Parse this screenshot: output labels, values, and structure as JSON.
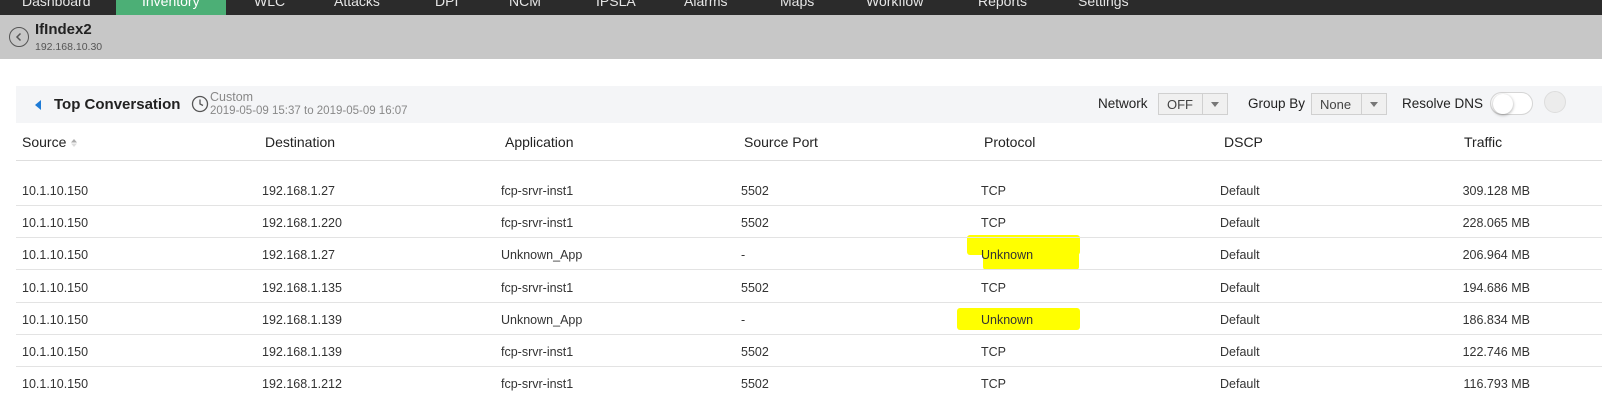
{
  "nav": {
    "items": [
      "Dashboard",
      "Inventory",
      "WLC",
      "Attacks",
      "DPI",
      "NCM",
      "IPSLA",
      "Alarms",
      "Maps",
      "Workflow",
      "Reports",
      "Settings"
    ],
    "active": "Inventory"
  },
  "device": {
    "name": "IfIndex2",
    "ip": "192.168.10.30"
  },
  "panel": {
    "title": "Top Conversation",
    "time_mode": "Custom",
    "time_range": "2019-05-09 15:37 to 2019-05-09 16:07",
    "network_label": "Network",
    "network_value": "OFF",
    "groupby_label": "Group By",
    "groupby_value": "None",
    "resolve_dns_label": "Resolve DNS",
    "resolve_dns_on": false
  },
  "table": {
    "columns": [
      "Source",
      "Destination",
      "Application",
      "Source Port",
      "Protocol",
      "DSCP",
      "Traffic"
    ],
    "sorted_by": "Source",
    "rows": [
      [
        "10.1.10.150",
        "192.168.1.27",
        "fcp-srvr-inst1",
        "5502",
        "TCP",
        "Default",
        "309.128 MB"
      ],
      [
        "10.1.10.150",
        "192.168.1.220",
        "fcp-srvr-inst1",
        "5502",
        "TCP",
        "Default",
        "228.065 MB"
      ],
      [
        "10.1.10.150",
        "192.168.1.27",
        "Unknown_App",
        "-",
        "Unknown",
        "Default",
        "206.964 MB"
      ],
      [
        "10.1.10.150",
        "192.168.1.135",
        "fcp-srvr-inst1",
        "5502",
        "TCP",
        "Default",
        "194.686 MB"
      ],
      [
        "10.1.10.150",
        "192.168.1.139",
        "Unknown_App",
        "-",
        "Unknown",
        "Default",
        "186.834 MB"
      ],
      [
        "10.1.10.150",
        "192.168.1.139",
        "fcp-srvr-inst1",
        "5502",
        "TCP",
        "Default",
        "122.746 MB"
      ],
      [
        "10.1.10.150",
        "192.168.1.212",
        "fcp-srvr-inst1",
        "5502",
        "TCP",
        "Default",
        "116.793 MB"
      ]
    ]
  },
  "colors": {
    "nav_bg": "#2b2b2b",
    "nav_active": "#4caf76",
    "device_bar": "#c7c7c7",
    "accent": "#1e7bd6",
    "highlight": "#ffff00"
  }
}
